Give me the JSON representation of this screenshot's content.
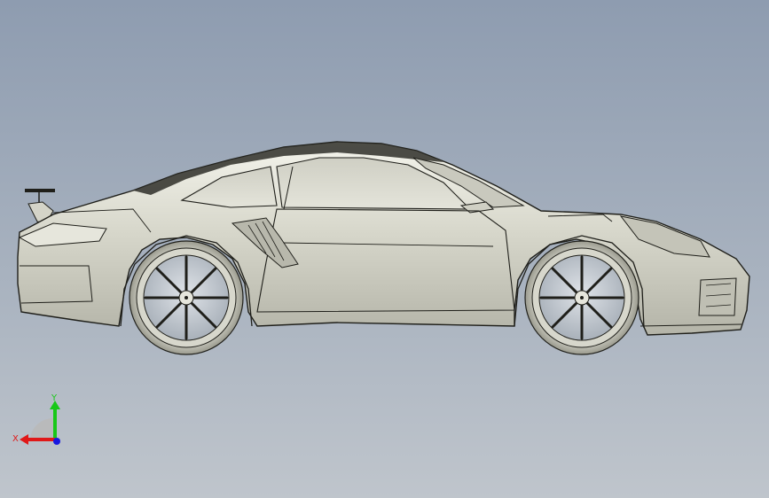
{
  "viewport": {
    "background_top": "#8e9cb0",
    "background_bottom": "#bfc5cc",
    "model": "car-body-side-view"
  },
  "colors": {
    "body_fill": "#dcdcd0",
    "body_highlight": "#f2f2ea",
    "body_shadow": "#8f8f84",
    "edge_line": "#1f1f1a",
    "glass": "#d6d6cc",
    "tire": "#c9c9bd",
    "wheel_fill": "#b9bfc6"
  },
  "triad": {
    "x_label": "X",
    "y_label": "Y",
    "x_color": "#e01818",
    "y_color": "#18c818",
    "z_color": "#1818e0"
  }
}
